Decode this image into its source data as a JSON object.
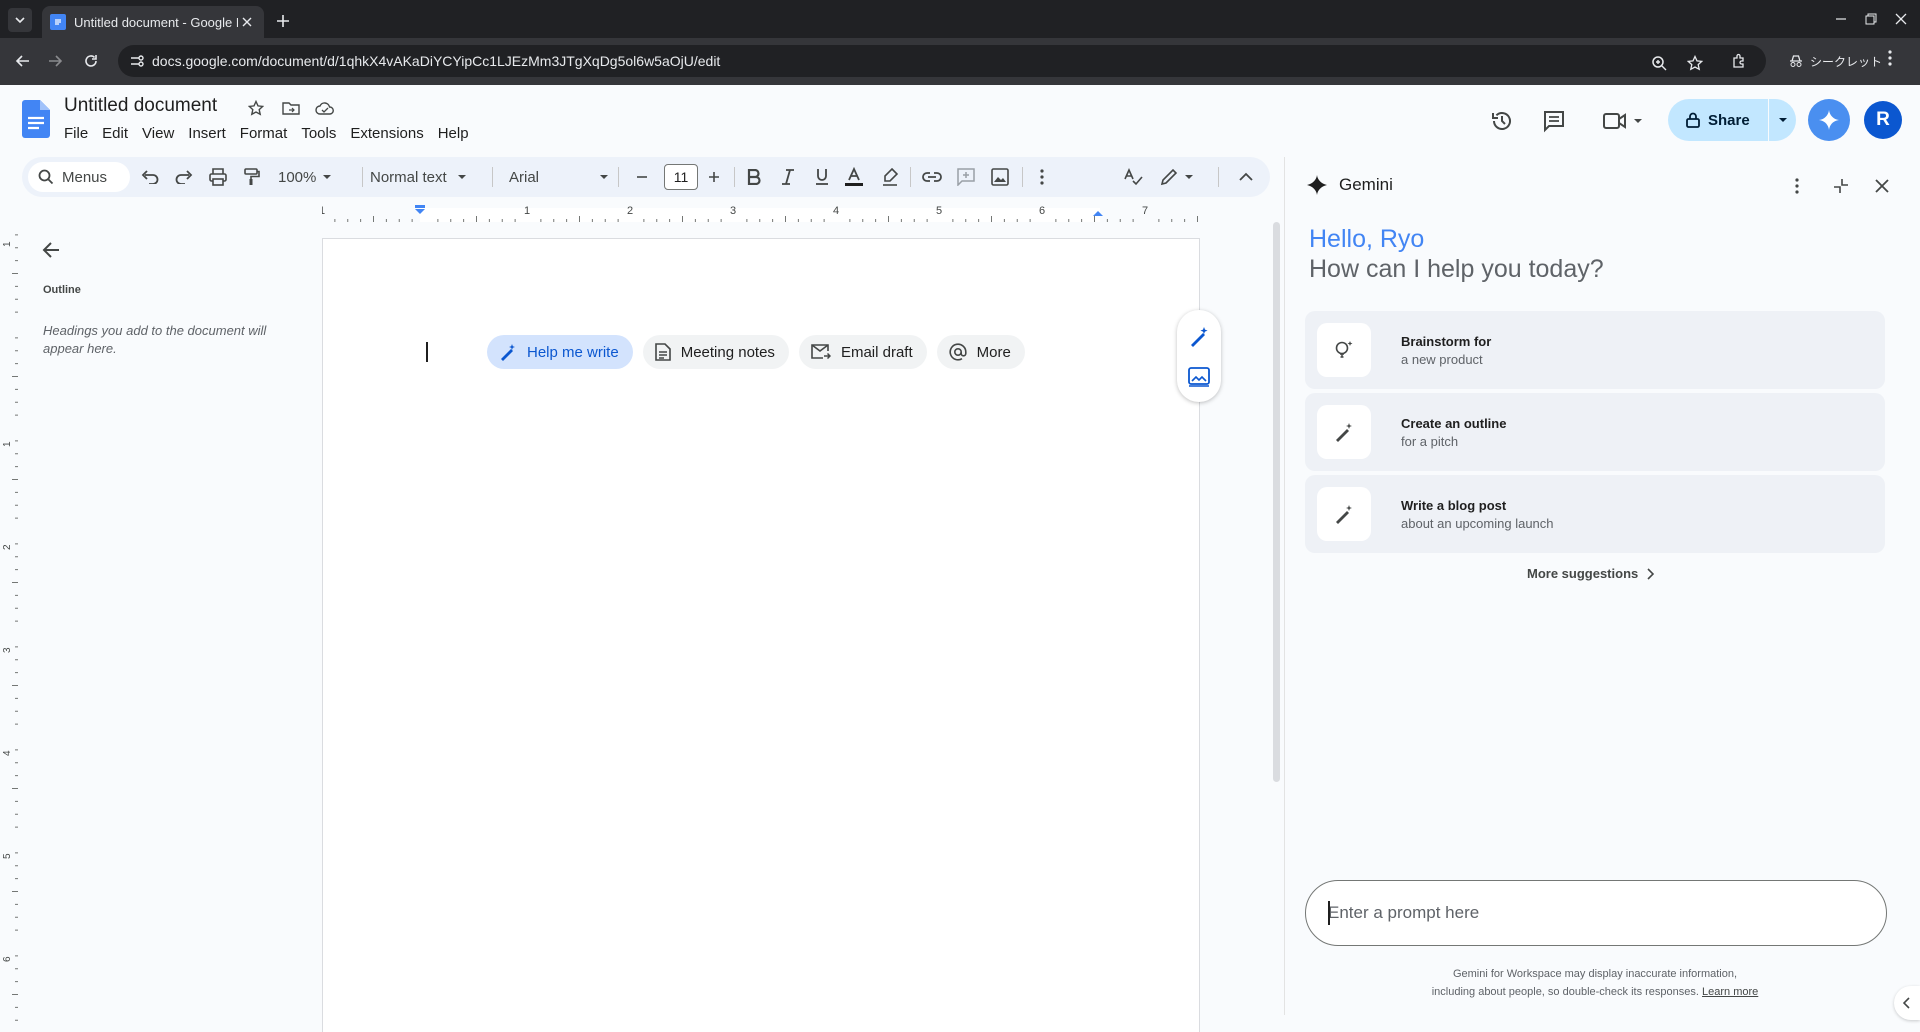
{
  "browser": {
    "tab_title": "Untitled document - Google Docs",
    "url": "docs.google.com/document/d/1qhkX4vAKaDiYCYipCc1LJEzMm3JTgXqDg5ol6w5aOjU/edit",
    "incognito_label": "シークレット"
  },
  "docs": {
    "title": "Untitled document",
    "menus": [
      "File",
      "Edit",
      "View",
      "Insert",
      "Format",
      "Tools",
      "Extensions",
      "Help"
    ],
    "share_label": "Share",
    "avatar_letter": "R"
  },
  "toolbar": {
    "search_label": "Menus",
    "zoom": "100%",
    "style": "Normal text",
    "font": "Arial",
    "font_size": "11"
  },
  "ruler": {
    "numbers": [
      "1",
      "1",
      "2",
      "3",
      "4",
      "5",
      "6",
      "7"
    ],
    "vertical_numbers": [
      "1",
      "1",
      "2",
      "3",
      "4",
      "5",
      "6"
    ]
  },
  "outline": {
    "label": "Outline",
    "hint": "Headings you add to the document will appear here."
  },
  "page": {
    "chips": [
      {
        "label": "Help me write",
        "icon": "pen-sparkle-icon"
      },
      {
        "label": "Meeting notes",
        "icon": "document-icon"
      },
      {
        "label": "Email draft",
        "icon": "email-icon"
      },
      {
        "label": "More",
        "icon": "at-sign-icon"
      }
    ]
  },
  "gemini": {
    "title": "Gemini",
    "hello": "Hello, Ryo",
    "subtitle": "How can I help you today?",
    "suggestions": [
      {
        "title": "Brainstorm for",
        "subtitle": "a new product",
        "icon": "lightbulb-icon"
      },
      {
        "title": "Create an outline",
        "subtitle": "for a pitch",
        "icon": "pen-sparkle-icon"
      },
      {
        "title": "Write a blog post",
        "subtitle": "about an upcoming launch",
        "icon": "pen-sparkle-icon"
      }
    ],
    "more_suggestions": "More suggestions",
    "prompt_placeholder": "Enter a prompt here",
    "disclaimer_line1": "Gemini for Workspace may display inaccurate information,",
    "disclaimer_line2": "including about people, so double-check its responses.",
    "learn_more": "Learn more"
  },
  "colors": {
    "accent_blue": "#0b57d0",
    "share_bg": "#c2e7ff",
    "gemini_hello": "#4285f4",
    "chip_primary_bg": "#d3e3fd"
  }
}
